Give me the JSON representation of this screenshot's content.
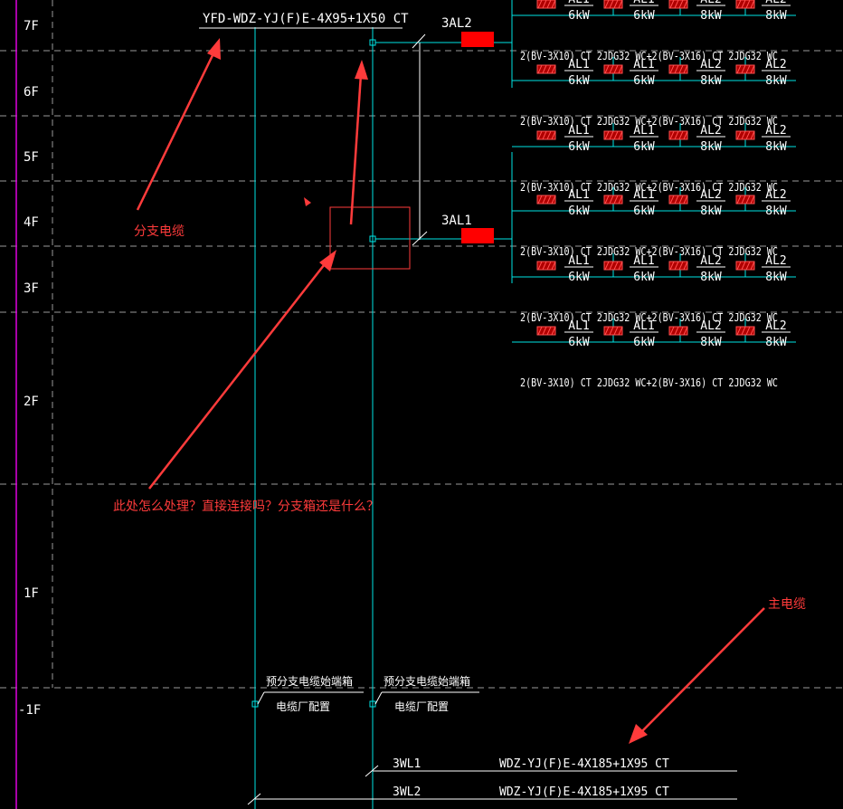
{
  "colors": {
    "background": "#000000",
    "white": "#ffffff",
    "cyan": "#00e5e5",
    "magenta": "#e000e0",
    "red": "#ff0000",
    "annotation": "#ff3b3b",
    "grid": "#9a9a9a",
    "hatch_fill": "#b00000",
    "hatch_line": "#ff5050"
  },
  "floors": [
    "7F",
    "6F",
    "5F",
    "4F",
    "3F",
    "2F",
    "1F",
    "-1F"
  ],
  "branch_cable_label": "YFD-WDZ-YJ(F)E-4X95+1X50 CT",
  "boxes": [
    "3AL2",
    "3AL1"
  ],
  "meters": [
    {
      "id": "AL1",
      "power": "6kW"
    },
    {
      "id": "AL1",
      "power": "6kW"
    },
    {
      "id": "AL2",
      "power": "8kW"
    },
    {
      "id": "AL2",
      "power": "8kW"
    }
  ],
  "feeder_text": "2(BV-3X10) CT 2JDG32 WC+2(BV-3X16) CT 2JDG32 WC",
  "basement_notes": [
    {
      "line1": "预分支电缆始端箱",
      "line2": "电缆厂配置"
    },
    {
      "line1": "预分支电缆始端箱",
      "line2": "电缆厂配置"
    }
  ],
  "main_feeders": [
    {
      "id": "3WL1",
      "spec": "WDZ-YJ(F)E-4X185+1X95 CT"
    },
    {
      "id": "3WL2",
      "spec": "WDZ-YJ(F)E-4X185+1X95 CT"
    }
  ],
  "annotations": {
    "branch_cable": "分支电缆",
    "question": "此处怎么处理？直接连接吗？分支箱还是什么？",
    "main_cable": "主电缆"
  }
}
